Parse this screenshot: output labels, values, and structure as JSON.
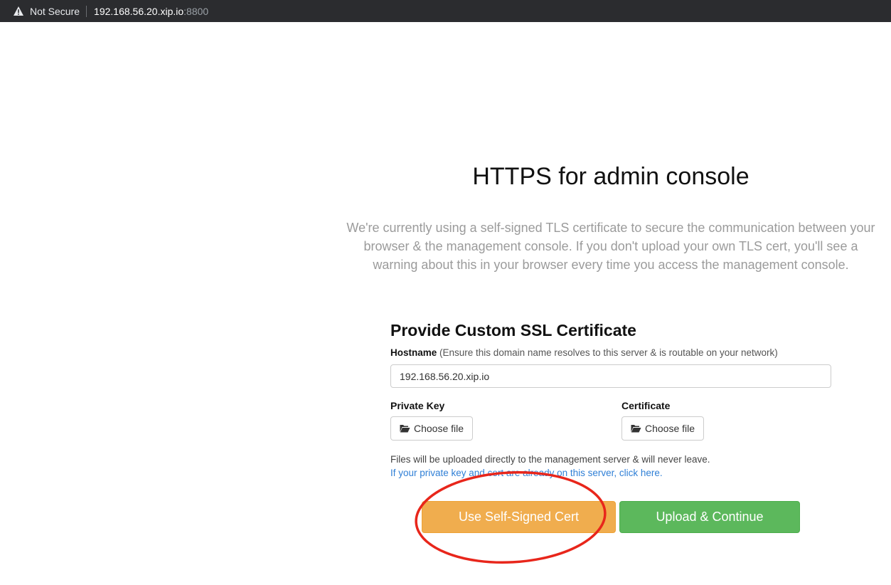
{
  "browser": {
    "security_label": "Not Secure",
    "url_host": "192.168.56.20.xip.io",
    "url_port": ":8800"
  },
  "page": {
    "title": "HTTPS for admin console",
    "intro": "We're currently using a self-signed TLS certificate to secure the communication between your browser & the management console. If you don't upload your own TLS cert, you'll see a warning about this in your browser every time you access the management console."
  },
  "form": {
    "section_title": "Provide Custom SSL Certificate",
    "hostname_label": "Hostname",
    "hostname_hint": "(Ensure this domain name resolves to this server & is routable on your network)",
    "hostname_value": "192.168.56.20.xip.io",
    "private_key_label": "Private Key",
    "certificate_label": "Certificate",
    "choose_file_label": "Choose file",
    "upload_note": "Files will be uploaded directly to the management server & will never leave.",
    "existing_link": "If your private key and cert are already on this server, click here."
  },
  "actions": {
    "self_signed_label": "Use Self-Signed Cert",
    "upload_label": "Upload & Continue"
  },
  "colors": {
    "warning_button": "#f0ad4e",
    "success_button": "#5cb85c",
    "link": "#2f7fd6",
    "annotation_ellipse": "#e8261b"
  }
}
